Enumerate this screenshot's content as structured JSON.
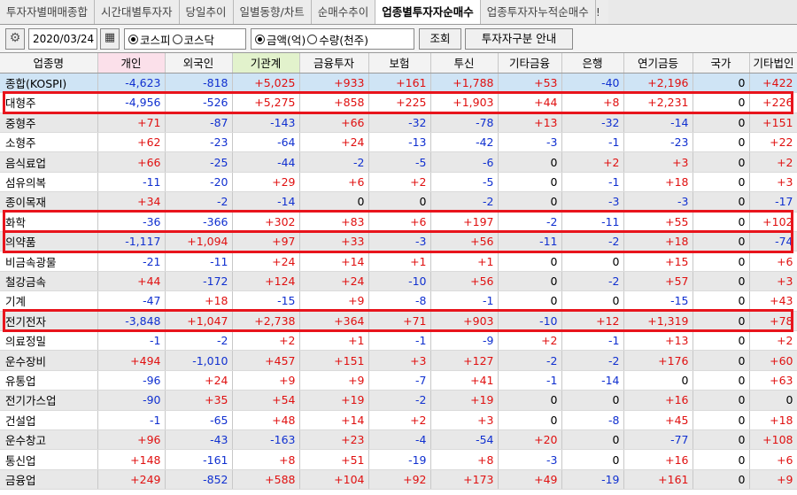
{
  "tabs": [
    "투자자별매매종합",
    "시간대별투자자",
    "당일추이",
    "일별동향/차트",
    "순매수추이",
    "업종별투자자순매수",
    "업종투자자누적순매수",
    "!"
  ],
  "active_tab": 5,
  "toolbar": {
    "date": "2020/03/24",
    "market_options": [
      "코스피",
      "코스닥"
    ],
    "market_selected": 0,
    "unit_options": [
      "금액(억)",
      "수량(천주)"
    ],
    "unit_selected": 0,
    "query_button": "조회",
    "guide_button": "투자자구분 안내"
  },
  "colors": {
    "positive": "#e01010",
    "negative": "#1030d0",
    "highlight": "#e8141c",
    "header_pink": "#fbe0ea",
    "header_green": "#e2f2cc"
  },
  "columns": [
    "업종명",
    "개인",
    "외국인",
    "기관계",
    "금융투자",
    "보험",
    "투신",
    "기타금융",
    "은행",
    "연기금등",
    "국가",
    "기타법인"
  ],
  "rows": [
    {
      "name": "종합(KOSPI)",
      "values": [
        "-4,623",
        "-818",
        "+5,025",
        "+933",
        "+161",
        "+1,788",
        "+53",
        "-40",
        "+2,196",
        "0",
        "+422"
      ]
    },
    {
      "name": "대형주",
      "values": [
        "-4,956",
        "-526",
        "+5,275",
        "+858",
        "+225",
        "+1,903",
        "+44",
        "+8",
        "+2,231",
        "0",
        "+226"
      ]
    },
    {
      "name": "중형주",
      "values": [
        "+71",
        "-87",
        "-143",
        "+66",
        "-32",
        "-78",
        "+13",
        "-32",
        "-14",
        "0",
        "+151"
      ]
    },
    {
      "name": "소형주",
      "values": [
        "+62",
        "-23",
        "-64",
        "+24",
        "-13",
        "-42",
        "-3",
        "-1",
        "-23",
        "0",
        "+22"
      ]
    },
    {
      "name": "음식료업",
      "values": [
        "+66",
        "-25",
        "-44",
        "-2",
        "-5",
        "-6",
        "0",
        "+2",
        "+3",
        "0",
        "+2"
      ]
    },
    {
      "name": "섬유의복",
      "values": [
        "-11",
        "-20",
        "+29",
        "+6",
        "+2",
        "-5",
        "0",
        "-1",
        "+18",
        "0",
        "+3"
      ]
    },
    {
      "name": "종이목재",
      "values": [
        "+34",
        "-2",
        "-14",
        "0",
        "0",
        "-2",
        "0",
        "-3",
        "-3",
        "0",
        "-17"
      ]
    },
    {
      "name": "화학",
      "values": [
        "-36",
        "-366",
        "+302",
        "+83",
        "+6",
        "+197",
        "-2",
        "-11",
        "+55",
        "0",
        "+102"
      ]
    },
    {
      "name": "의약품",
      "values": [
        "-1,117",
        "+1,094",
        "+97",
        "+33",
        "-3",
        "+56",
        "-11",
        "-2",
        "+18",
        "0",
        "-74"
      ]
    },
    {
      "name": "비금속광물",
      "values": [
        "-21",
        "-11",
        "+24",
        "+14",
        "+1",
        "+1",
        "0",
        "0",
        "+15",
        "0",
        "+6"
      ]
    },
    {
      "name": "철강금속",
      "values": [
        "+44",
        "-172",
        "+124",
        "+24",
        "-10",
        "+56",
        "0",
        "-2",
        "+57",
        "0",
        "+3"
      ]
    },
    {
      "name": "기계",
      "values": [
        "-47",
        "+18",
        "-15",
        "+9",
        "-8",
        "-1",
        "0",
        "0",
        "-15",
        "0",
        "+43"
      ]
    },
    {
      "name": "전기전자",
      "values": [
        "-3,848",
        "+1,047",
        "+2,738",
        "+364",
        "+71",
        "+903",
        "-10",
        "+12",
        "+1,319",
        "0",
        "+78"
      ]
    },
    {
      "name": "의료정밀",
      "values": [
        "-1",
        "-2",
        "+2",
        "+1",
        "-1",
        "-9",
        "+2",
        "-1",
        "+13",
        "0",
        "+2"
      ]
    },
    {
      "name": "운수장비",
      "values": [
        "+494",
        "-1,010",
        "+457",
        "+151",
        "+3",
        "+127",
        "-2",
        "-2",
        "+176",
        "0",
        "+60"
      ]
    },
    {
      "name": "유통업",
      "values": [
        "-96",
        "+24",
        "+9",
        "+9",
        "-7",
        "+41",
        "-1",
        "-14",
        "0",
        "0",
        "+63"
      ]
    },
    {
      "name": "전기가스업",
      "values": [
        "-90",
        "+35",
        "+54",
        "+19",
        "-2",
        "+19",
        "0",
        "0",
        "+16",
        "0",
        "0"
      ]
    },
    {
      "name": "건설업",
      "values": [
        "-1",
        "-65",
        "+48",
        "+14",
        "+2",
        "+3",
        "0",
        "-8",
        "+45",
        "0",
        "+18"
      ]
    },
    {
      "name": "운수창고",
      "values": [
        "+96",
        "-43",
        "-163",
        "+23",
        "-4",
        "-54",
        "+20",
        "0",
        "-77",
        "0",
        "+108"
      ]
    },
    {
      "name": "통신업",
      "values": [
        "+148",
        "-161",
        "+8",
        "+51",
        "-19",
        "+8",
        "-3",
        "0",
        "+16",
        "0",
        "+6"
      ]
    },
    {
      "name": "금융업",
      "values": [
        "+249",
        "-852",
        "+588",
        "+104",
        "+92",
        "+173",
        "+49",
        "-19",
        "+161",
        "0",
        "+9"
      ]
    }
  ],
  "highlighted_rows": [
    "대형주",
    "화학",
    "의약품",
    "전기전자"
  ]
}
